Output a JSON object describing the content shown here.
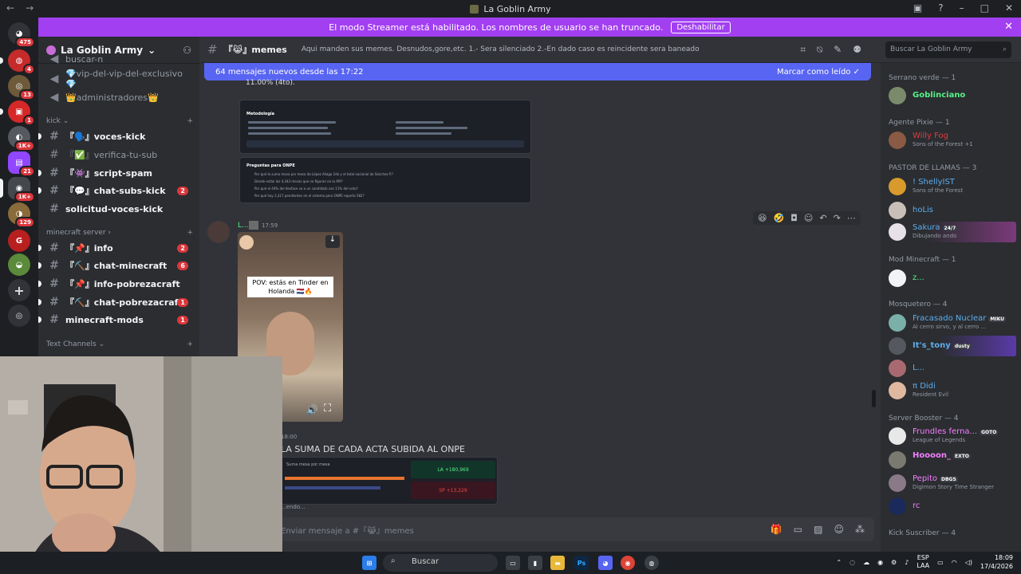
{
  "window": {
    "title": "La Goblin Army"
  },
  "banner": {
    "text": "El modo Streamer está habilitado. Los nombres de usuario se han truncado.",
    "button": "Deshabilitar"
  },
  "servers": [
    {
      "badge": "475"
    },
    {
      "badge": "4"
    },
    {
      "badge": "13"
    },
    {
      "badge": "1"
    },
    {
      "badge": "1K+"
    },
    {
      "badge": "21"
    },
    {
      "badge": "1K+"
    },
    {
      "badge": "129"
    }
  ],
  "sidebar": {
    "server_name": "La Goblin Army",
    "top_items": [
      "buscar-n",
      "💎vip-del-vip-del-exclusivo💎",
      "👑administradores👑"
    ],
    "categories": {
      "kick": "kick",
      "minecraft": "minecraft server",
      "text": "Text Channels"
    },
    "kick_channels": [
      {
        "label": "『🗣️』voces-kick",
        "count": ""
      },
      {
        "label": "『✅』verifica-tu-sub",
        "count": ""
      },
      {
        "label": "『👾』script-spam",
        "count": ""
      },
      {
        "label": "『💬』chat-subs-kick",
        "count": "2"
      },
      {
        "label": "solicitud-voces-kick",
        "count": ""
      }
    ],
    "mc_channels": [
      {
        "label": "『📌』info",
        "count": "2"
      },
      {
        "label": "『⛏️』chat-minecraft",
        "count": "6"
      },
      {
        "label": "『📌』info-pobrezacraft",
        "count": ""
      },
      {
        "label": "『⛏️』chat-pobrezacraft",
        "count": "1"
      },
      {
        "label": "minecraft-mods",
        "count": "1"
      }
    ]
  },
  "header": {
    "channel": "『😹』memes",
    "topic": "Aqui manden sus memes. Desnudos,gore,etc. 1.- Sera silenciado 2.-En dado caso es reincidente sera baneado",
    "search_placeholder": "Buscar La Goblin Army"
  },
  "chat": {
    "new_messages": "64 mensajes nuevos desde las 17:22",
    "mark_read": "Marcar como leído",
    "top_text": "11.00% (4to).",
    "card_heading_1": "Metodología",
    "card_heading_2": "Preguntas para ONPE",
    "card_questions": [
      "Por qué la suma mesa por mesa da López Aliaga 2do y el total nacional da Sánchez P.?",
      "Donde están las 4,343 mesas que no figuran en la API?",
      "Por qué el 44% del desfase va a un candidato con 11% del voto?",
      "Por qué hay 2,317 pendientes en el sistema pero ONPE reporta 582?"
    ],
    "msg_time": "17:59",
    "msg_author": "L...",
    "video_caption": "POV: estás en Tinder en Holanda 🇳🇱🔥",
    "msg2_time": "18:00",
    "msg2_text": "LA SUMA DE CADA ACTA SUBIDA AL ONPE",
    "msg2_sub": "Suma mesa por mesa",
    "msg2_box1": "LA +180,969",
    "msg2_box2": "SP +13,229",
    "msg2_footer": "...endo...",
    "composer_placeholder": "Enviar mensaje a #『😹』memes"
  },
  "members": {
    "groups": [
      {
        "title": "Serrano verde — 1",
        "members": [
          {
            "name": "Goblinciano",
            "color": "#57f287",
            "status": ""
          }
        ]
      },
      {
        "title": "Agente Pixie — 1",
        "members": [
          {
            "name": "Willy Fog",
            "color": "#e03c3c",
            "status": "Sons of the Forest +1"
          }
        ]
      },
      {
        "title": "PASTOR DE LLAMAS — 3",
        "members": [
          {
            "name": "! ShellyIST",
            "color": "#5dadec",
            "status": "Sons of the Forest"
          },
          {
            "name": "hoLis",
            "color": "#5dadec",
            "status": ""
          },
          {
            "name": "Sakura",
            "color": "#5dadec",
            "status": "Dibujando ando"
          }
        ]
      },
      {
        "title": "Mod Minecraft — 1",
        "members": [
          {
            "name": "z...",
            "color": "#57f287",
            "status": ""
          }
        ]
      },
      {
        "title": "Mosquetero — 4",
        "members": [
          {
            "name": "Fracasado Nuclear",
            "color": "#5dadec",
            "status": "Al cerro sirvo, y al cerro ..."
          },
          {
            "name": "It's_tony",
            "color": "#5dadec",
            "status": ""
          },
          {
            "name": "L...",
            "color": "#5dadec",
            "status": ""
          },
          {
            "name": "π Didi",
            "color": "#5dadec",
            "status": "Resident Evil"
          }
        ]
      },
      {
        "title": "Server Booster — 4",
        "members": [
          {
            "name": "Frundles ferna...",
            "color": "#f47fff",
            "status": "League of Legends"
          },
          {
            "name": "Hoooon_",
            "color": "#f47fff",
            "status": ""
          },
          {
            "name": "Pepito",
            "color": "#f47fff",
            "status": "Digimon Story Time Stranger"
          },
          {
            "name": "rc",
            "color": "#f47fff",
            "status": ""
          }
        ]
      },
      {
        "title": "Kick Suscriber — 4",
        "members": []
      }
    ],
    "tags": {
      "sakura": "24/7",
      "miku": "MIKU",
      "tony": "dusty",
      "frundles": "GOTO",
      "hoooon": "EXTO",
      "pepito": "DBGS"
    }
  },
  "taskbar": {
    "search": "Buscar",
    "lang": "ESP",
    "lang2": "LAA",
    "time": "18:09",
    "date": "17/4/2026"
  }
}
